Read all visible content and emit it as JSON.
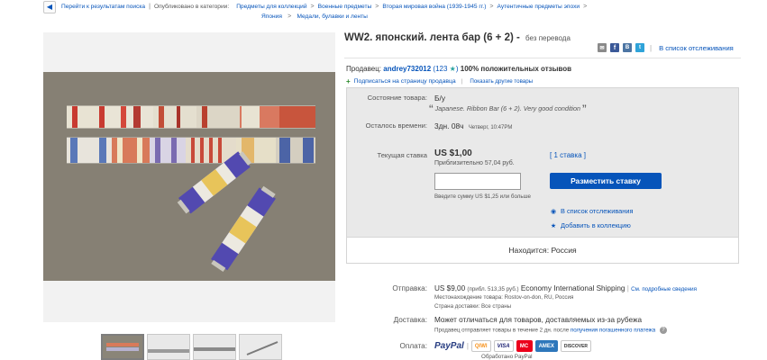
{
  "breadcrumb": {
    "back_icon": "chevron-left-icon",
    "items": [
      "Перейти к результатам поиска",
      "Опубликовано в категории:",
      "Предметы для коллекций",
      "Военные предметы",
      "Вторая мировая война (1939-1945 гг.)",
      "Аутентичные предметы эпохи",
      "Япония",
      "Медали, булавки и ленты"
    ]
  },
  "listing": {
    "title": "WW2. японский. лента бар (6 + 2) -",
    "title_note": "без перевода",
    "watch_link": "В список отслеживания"
  },
  "seller": {
    "label": "Продавец:",
    "name": "andrey732012",
    "score": "(123",
    "score_close": ")",
    "positive": "100% положительных отзывов",
    "subscribe": "Подписаться на страницу продавца",
    "other_items": "Показать другие товары"
  },
  "details": {
    "condition_label": "Состояние товара:",
    "condition_value": "Б/у",
    "condition_note": "Japanese. Ribbon Bar (6 + 2). Very good condition",
    "time_label": "Осталось времени:",
    "time_value": "3дн. 08ч",
    "time_detail": "Четверг, 10:47PM",
    "bid_label": "Текущая ставка",
    "price": "US $1,00",
    "approx": "Приблизительно 57,04 руб.",
    "bids": "[ 1 ставка ]",
    "bid_button": "Разместить ставку",
    "bid_hint": "Введите сумму US $1,25 или больше",
    "watch_link": "В список отслеживания",
    "collection_link": "Добавить в коллекцию",
    "location": "Находится: Россия"
  },
  "shipping": {
    "ship_label": "Отправка:",
    "ship_price": "US $9,00",
    "ship_approx": "(прибл. 513,35 руб.)",
    "ship_service": "Economy International Shipping",
    "ship_details": "См. подробные сведения",
    "item_location": "Местонахождение товара: Rostov-on-don, RU, Россия",
    "ship_countries": "Страна доставки: Все страны",
    "delivery_label": "Доставка:",
    "delivery_value": "Может отличаться для товаров, доставляемых из-за рубежа",
    "delivery_note": "Продавец отправляет товары в течение 2 дн. после",
    "delivery_link": "получения погашенного платежа",
    "payment_label": "Оплата:",
    "payment_logos": [
      "PayPal",
      "QIWI",
      "VISA",
      "MC",
      "AMEX",
      "DISCOVER"
    ],
    "payment_note": "Обработано PayPal"
  },
  "colors": {
    "link": "#0654ba",
    "button": "#0654ba",
    "box_grey": "#e9e9e9"
  }
}
